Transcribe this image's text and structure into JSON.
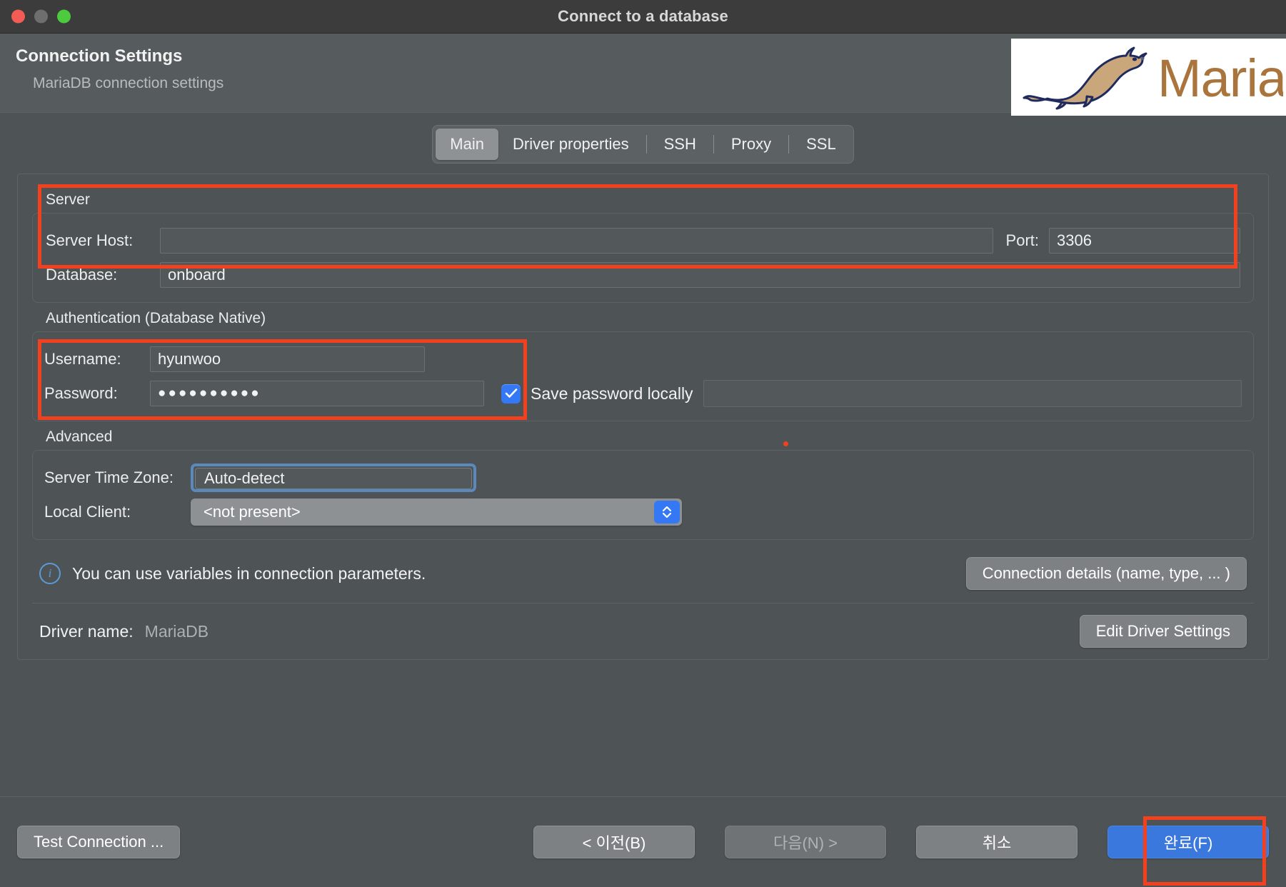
{
  "window": {
    "title": "Connect to a database",
    "traffic_lights": [
      "close",
      "minimize",
      "zoom"
    ]
  },
  "header": {
    "title": "Connection Settings",
    "subtitle": "MariaDB connection settings",
    "logo_text": "MariaDB"
  },
  "tabs": [
    {
      "label": "Main",
      "active": true
    },
    {
      "label": "Driver properties",
      "active": false
    },
    {
      "label": "SSH",
      "active": false
    },
    {
      "label": "Proxy",
      "active": false
    },
    {
      "label": "SSL",
      "active": false
    }
  ],
  "server": {
    "group_label": "Server",
    "host_label": "Server Host:",
    "host_value": "",
    "host_redacted": true,
    "port_label": "Port:",
    "port_value": "3306",
    "database_label": "Database:",
    "database_value": "onboard"
  },
  "authentication": {
    "group_label": "Authentication (Database Native)",
    "username_label": "Username:",
    "username_value": "hyunwoo",
    "password_label": "Password:",
    "password_value": "●●●●●●●●●●",
    "save_password_label": "Save password locally",
    "save_password_checked": true
  },
  "advanced": {
    "group_label": "Advanced",
    "timezone_label": "Server Time Zone:",
    "timezone_value": "Auto-detect",
    "local_client_label": "Local Client:",
    "local_client_value": "<not present>"
  },
  "info": {
    "icon": "info-circle-icon",
    "text": "You can use variables in connection parameters.",
    "details_button": "Connection details (name, type, ... )"
  },
  "driver": {
    "label": "Driver name:",
    "value": "MariaDB",
    "edit_button": "Edit Driver Settings"
  },
  "footer": {
    "test_connection": "Test Connection ...",
    "back": "< 이전(B)",
    "next": "다음(N) >",
    "next_disabled": true,
    "cancel": "취소",
    "finish": "완료(F)"
  },
  "annotations": {
    "color": "#f3401f",
    "boxes": [
      "server-group",
      "authentication-group",
      "finish-button"
    ]
  },
  "colors": {
    "window_bg": "#4e5356",
    "titlebar_bg": "#3c3c3c",
    "accent_blue": "#3478f6",
    "primary_button": "#3b78dd",
    "annotation_red": "#f3401f",
    "logo_body": "#c9a77a",
    "logo_outline": "#1f2a5e",
    "logo_text": "#a9753c"
  }
}
